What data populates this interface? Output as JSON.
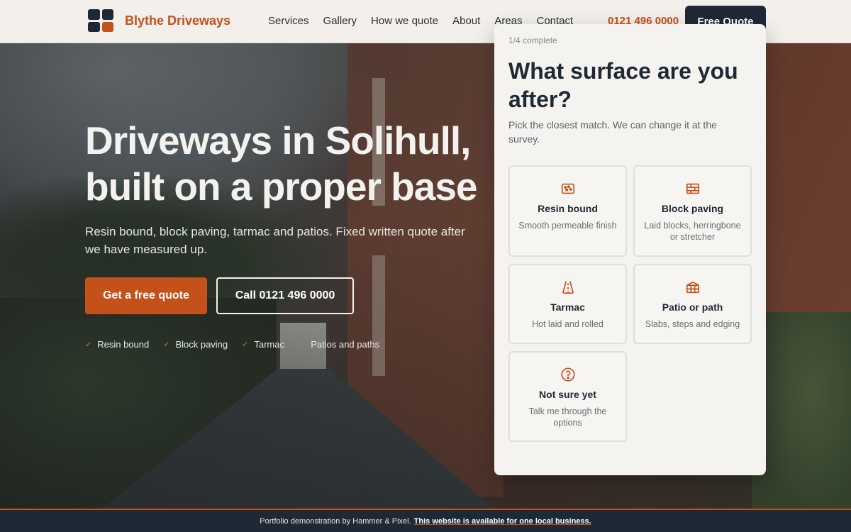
{
  "header": {
    "brand": "Blythe Driveways",
    "nav": [
      "Services",
      "Gallery",
      "How we quote",
      "About",
      "Areas",
      "Contact"
    ],
    "phone": "0121 496 0000",
    "cta": "Free Quote"
  },
  "hero": {
    "title": "Driveways in Solihull, built on a proper base",
    "subtitle": "Resin bound, block paving, tarmac and patios. Fixed written quote after we have measured up.",
    "primary_button": "Get a free quote",
    "secondary_button": "Call 0121 496 0000",
    "checks": [
      "Resin bound",
      "Block paving",
      "Tarmac",
      "Patios and paths"
    ]
  },
  "quote_form": {
    "step": "1/4 complete",
    "title": "What surface are you after?",
    "subtitle": "Pick the closest match. We can change it at the survey.",
    "options": [
      {
        "title": "Resin bound",
        "desc": "Smooth permeable finish",
        "icon": "resin-icon"
      },
      {
        "title": "Block paving",
        "desc": "Laid blocks, herringbone or stretcher",
        "icon": "block-paving-icon"
      },
      {
        "title": "Tarmac",
        "desc": "Hot laid and rolled",
        "icon": "road-icon"
      },
      {
        "title": "Patio or path",
        "desc": "Slabs, steps and edging",
        "icon": "patio-icon"
      },
      {
        "title": "Not sure yet",
        "desc": "Talk me through the options",
        "icon": "question-icon"
      }
    ]
  },
  "footer": {
    "text": "Portfolio demonstration by Hammer & Pixel.",
    "link": "This website is available for one local business."
  },
  "colors": {
    "accent": "#c4501a",
    "navy": "#1f2835",
    "cream": "#f3f0eb"
  }
}
